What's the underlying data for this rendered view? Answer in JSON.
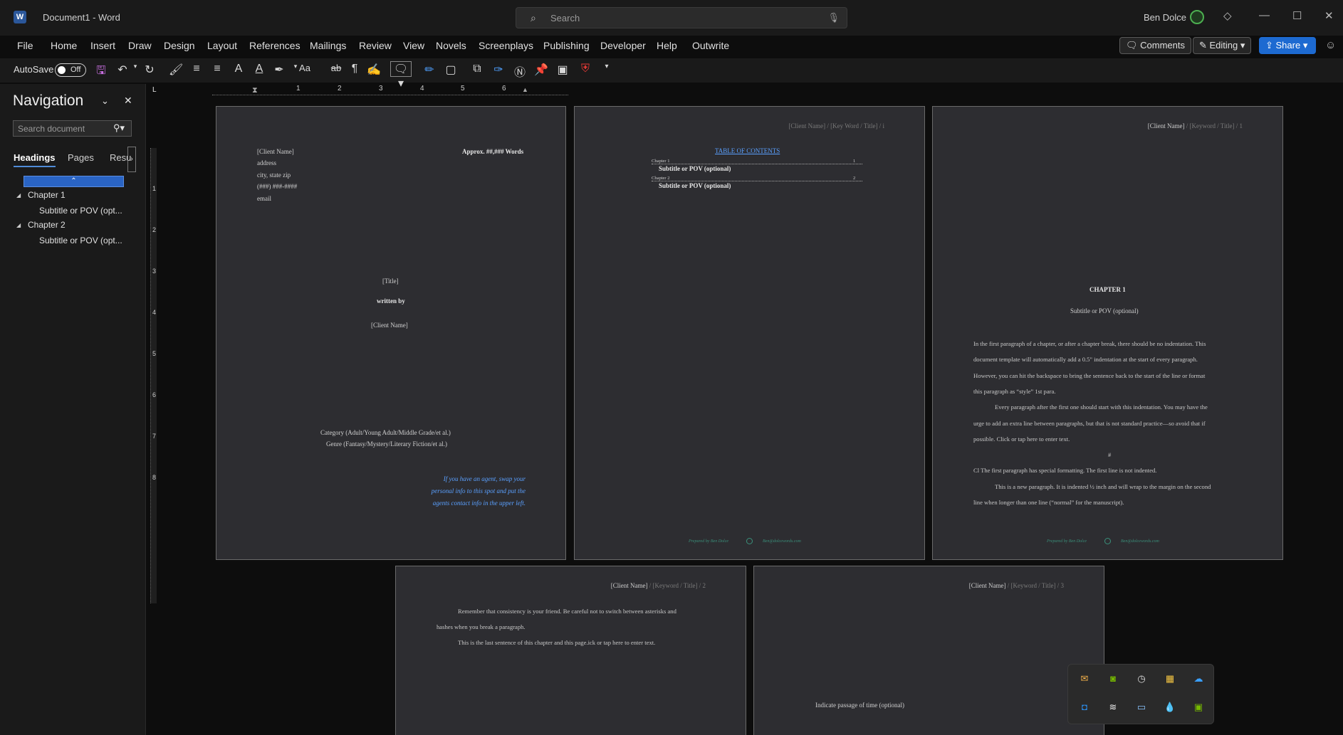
{
  "app": {
    "logo_letter": "W",
    "title": "Document1 - Word",
    "search_placeholder": "Search",
    "user_name": "Ben Dolce"
  },
  "menu": [
    "File",
    "Home",
    "Insert",
    "Draw",
    "Design",
    "Layout",
    "References",
    "Mailings",
    "Review",
    "View",
    "Novels",
    "Screenplays",
    "Publishing",
    "Developer",
    "Help",
    "Outwrite"
  ],
  "ribbon_buttons": {
    "comments": "Comments",
    "editing": "Editing",
    "share": "Share"
  },
  "toolbar": {
    "autosave_label": "AutoSave",
    "autosave_state": "Off"
  },
  "navigation": {
    "title": "Navigation",
    "search_placeholder": "Search document",
    "tabs": [
      "Headings",
      "Pages",
      "Resu"
    ],
    "items": [
      {
        "label": "Chapter 1",
        "level": 1
      },
      {
        "label": "Subtitle or POV (opt...",
        "level": 2
      },
      {
        "label": "Chapter 2",
        "level": 1
      },
      {
        "label": "Subtitle or POV (opt...",
        "level": 2
      }
    ]
  },
  "ruler": {
    "h_numbers": [
      "1",
      "2",
      "3",
      "4",
      "5",
      "6"
    ],
    "v_numbers": [
      "1",
      "2",
      "3",
      "4",
      "5",
      "6",
      "7",
      "8"
    ]
  },
  "pages": {
    "p1": {
      "client": "[Client Name]",
      "address": "address",
      "city": "city, state zip",
      "phone": "(###) ###-####",
      "email": "email",
      "words": "Approx. ##,### Words",
      "title": "[Title]",
      "written_by": "written by",
      "client2": "[Client Name]",
      "category": "Category (Adult/Young Adult/Middle Grade/et al.)",
      "genre": "Genre (Fantasy/Mystery/Literary Fiction/et al.)",
      "agent_note": [
        "If you have an agent, swap your",
        "personal info to this spot and put the",
        "agents contact info in the upper left."
      ]
    },
    "p2": {
      "header_a": "[Client Name]",
      "header_b": " / [Key Word / Title] / i",
      "toc_title": "TABLE OF CONTENTS",
      "toc": [
        {
          "entry": "Chapter 1",
          "page": "1",
          "sub": "Subtitle or POV (optional)"
        },
        {
          "entry": "Chapter 2",
          "page": "2",
          "sub": "Subtitle or POV (optional)"
        }
      ],
      "footer_prepared": "Prepared by Ben Dolce",
      "footer_email": "Ben@dolcewords.com"
    },
    "p3": {
      "header_a": "[Client Name]",
      "header_b": " / [Keyword / Title] / 1",
      "chapter": "CHAPTER 1",
      "subtitle": "Subtitle or POV (optional)",
      "lines": [
        "In the first paragraph of a chapter, or after a chapter break, there should be no indentation. This",
        "document template will automatically add a 0.5\" indentation at the start of every paragraph.",
        "However, you can hit the backspace to bring the sentence back to the start of the line or format",
        "this paragraph as “style” 1st para.",
        "Every paragraph after the first one should start with this indentation. You may have the",
        "urge to add an extra line between paragraphs, but that is not standard practice—so avoid that if",
        "possible. Click or tap here to enter text.",
        "#",
        "Cl The first paragraph has special formatting. The first line is not indented.",
        "This is a new paragraph. It is indented ½ inch and will wrap to the margin on the second",
        "line when longer than one line (“normal” for the manuscript)."
      ],
      "footer_prepared": "Prepared by Ben Dolce",
      "footer_email": "Ben@dolcewords.com"
    },
    "p4": {
      "header_a": "[Client Name]",
      "header_b": " / [Keyword / Title] / 2",
      "lines": [
        "Remember that consistency is your friend. Be careful not to switch between asterisks and",
        "hashes when you break a paragraph.",
        "This is the last sentence of this chapter and this page.ick or tap here to enter text."
      ]
    },
    "p5": {
      "header_a": "[Client Name]",
      "header_b": " / [Keyword / Title] / 3",
      "passage": "Indicate passage of time (optional)"
    }
  },
  "tray_icons": [
    "mail-icon",
    "nvidia-icon",
    "clock-icon",
    "photo-icon",
    "onedrive-icon",
    "outlook-icon",
    "app-icon",
    "display-icon",
    "drop-icon",
    "gpu-icon"
  ],
  "colors": {
    "accent": "#1d6ad1",
    "page_bg": "#2d2d31",
    "link_blue": "#5aa0ff"
  }
}
